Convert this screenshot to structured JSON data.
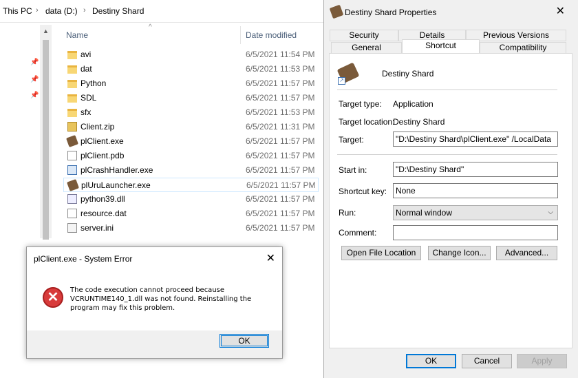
{
  "explorer": {
    "breadcrumb": [
      "This PC",
      "data (D:)",
      "Destiny Shard"
    ],
    "columns": {
      "name": "Name",
      "date": "Date modified"
    },
    "files": [
      {
        "name": "avi",
        "date": "6/5/2021 11:54 PM",
        "icon": "folder-icon"
      },
      {
        "name": "dat",
        "date": "6/5/2021 11:53 PM",
        "icon": "folder-icon"
      },
      {
        "name": "Python",
        "date": "6/5/2021 11:57 PM",
        "icon": "folder-icon"
      },
      {
        "name": "SDL",
        "date": "6/5/2021 11:57 PM",
        "icon": "folder-icon"
      },
      {
        "name": "sfx",
        "date": "6/5/2021 11:53 PM",
        "icon": "folder-icon"
      },
      {
        "name": "Client.zip",
        "date": "6/5/2021 11:31 PM",
        "icon": "zip-icon"
      },
      {
        "name": "plClient.exe",
        "date": "6/5/2021 11:57 PM",
        "icon": "shard-app-icon"
      },
      {
        "name": "plClient.pdb",
        "date": "6/5/2021 11:57 PM",
        "icon": "file-icon"
      },
      {
        "name": "plCrashHandler.exe",
        "date": "6/5/2021 11:57 PM",
        "icon": "exe-window-icon"
      },
      {
        "name": "plUruLauncher.exe",
        "date": "6/5/2021 11:57 PM",
        "icon": "shard-app-icon"
      },
      {
        "name": "python39.dll",
        "date": "6/5/2021 11:57 PM",
        "icon": "dll-icon"
      },
      {
        "name": "resource.dat",
        "date": "6/5/2021 11:57 PM",
        "icon": "file-icon"
      },
      {
        "name": "server.ini",
        "date": "6/5/2021 11:57 PM",
        "icon": "ini-icon"
      }
    ]
  },
  "error_dialog": {
    "title": "plClient.exe - System Error",
    "message": "The code execution cannot proceed because VCRUNTIME140_1.dll was not found. Reinstalling the program may fix this problem.",
    "ok": "OK"
  },
  "properties": {
    "title": "Destiny Shard Properties",
    "tabs_top": [
      "Security",
      "Details",
      "Previous Versions"
    ],
    "tabs_bottom": [
      "General",
      "Shortcut",
      "Compatibility"
    ],
    "active_tab": "Shortcut",
    "shortcut_name": "Destiny Shard",
    "target_type_label": "Target type:",
    "target_type": "Application",
    "target_location_label": "Target location:",
    "target_location": "Destiny Shard",
    "target_label": "Target:",
    "target": "\"D:\\Destiny Shard\\plClient.exe\" /LocalData",
    "start_in_label": "Start in:",
    "start_in": "\"D:\\Destiny Shard\"",
    "shortcut_key_label": "Shortcut key:",
    "shortcut_key": "None",
    "run_label": "Run:",
    "run": "Normal window",
    "comment_label": "Comment:",
    "comment": "",
    "buttons": {
      "open_location": "Open File Location",
      "change_icon": "Change Icon...",
      "advanced": "Advanced..."
    },
    "footer": {
      "ok": "OK",
      "cancel": "Cancel",
      "apply": "Apply"
    }
  }
}
